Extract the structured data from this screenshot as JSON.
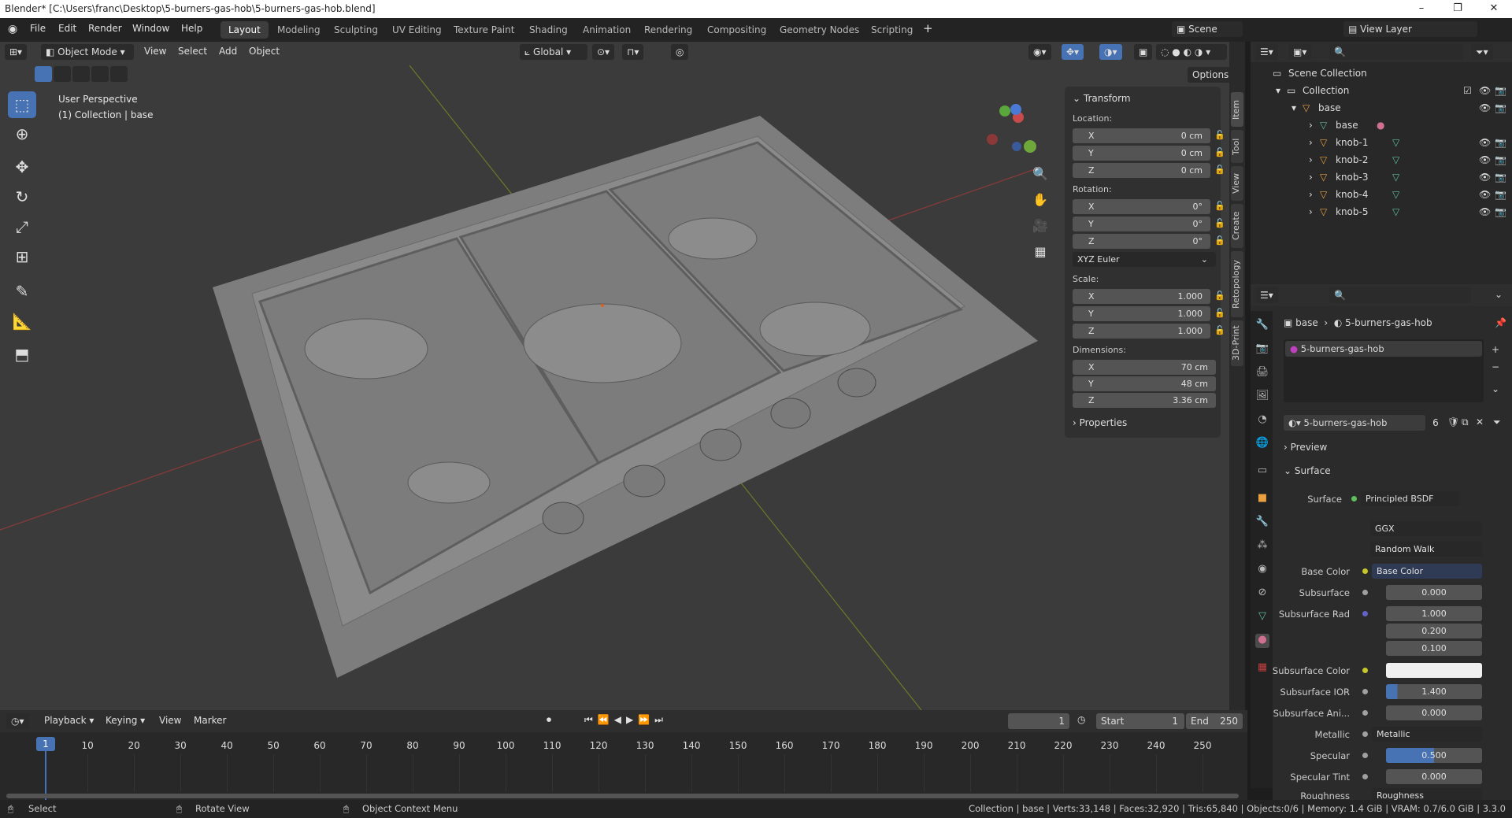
{
  "window": {
    "title": "Blender* [C:\\Users\\franc\\Desktop\\5-burners-gas-hob\\5-burners-gas-hob.blend]"
  },
  "menu": [
    "File",
    "Edit",
    "Render",
    "Window",
    "Help"
  ],
  "workspaces": [
    "Layout",
    "Modeling",
    "Sculpting",
    "UV Editing",
    "Texture Paint",
    "Shading",
    "Animation",
    "Rendering",
    "Compositing",
    "Geometry Nodes",
    "Scripting"
  ],
  "scene": "Scene",
  "view_layer": "View Layer",
  "viewport": {
    "mode": "Object Mode",
    "menus": [
      "View",
      "Select",
      "Add",
      "Object"
    ],
    "orientation": "Global",
    "options": "Options",
    "info_line1": "User Perspective",
    "info_line2": "(1) Collection | base"
  },
  "npanel": {
    "header": "Transform",
    "location_label": "Location:",
    "location": [
      {
        "k": "X",
        "v": "0 cm"
      },
      {
        "k": "Y",
        "v": "0 cm"
      },
      {
        "k": "Z",
        "v": "0 cm"
      }
    ],
    "rotation_label": "Rotation:",
    "rotation": [
      {
        "k": "X",
        "v": "0°"
      },
      {
        "k": "Y",
        "v": "0°"
      },
      {
        "k": "Z",
        "v": "0°"
      }
    ],
    "rotation_mode": "XYZ Euler",
    "scale_label": "Scale:",
    "scale": [
      {
        "k": "X",
        "v": "1.000"
      },
      {
        "k": "Y",
        "v": "1.000"
      },
      {
        "k": "Z",
        "v": "1.000"
      }
    ],
    "dimensions_label": "Dimensions:",
    "dimensions": [
      {
        "k": "X",
        "v": "70 cm"
      },
      {
        "k": "Y",
        "v": "48 cm"
      },
      {
        "k": "Z",
        "v": "3.36 cm"
      }
    ],
    "properties": "Properties",
    "tabs": [
      "Item",
      "Tool",
      "View",
      "Create",
      "Retopology",
      "3D-Print"
    ]
  },
  "outliner": {
    "scene_collection": "Scene Collection",
    "collection": "Collection",
    "items": [
      "base",
      "base",
      "knob-1",
      "knob-2",
      "knob-3",
      "knob-4",
      "knob-5"
    ]
  },
  "properties": {
    "breadcrumb_obj": "base",
    "breadcrumb_mat": "5-burners-gas-hob",
    "slot": "5-burners-gas-hob",
    "material": "5-burners-gas-hob",
    "users": "6",
    "preview": "Preview",
    "surface_header": "Surface",
    "rows": [
      {
        "l": "Surface",
        "v": "Principled BSDF",
        "c": "#5fbf5f"
      },
      {
        "l": "",
        "v": "GGX",
        "c": ""
      },
      {
        "l": "",
        "v": "Random Walk",
        "c": ""
      },
      {
        "l": "Base Color",
        "v": "Base Color",
        "c": "#c7c729"
      },
      {
        "l": "Subsurface",
        "v": "0.000",
        "c": "#a0a0a0"
      },
      {
        "l": "Subsurface Rad",
        "v": "1.000",
        "c": "#6363c7"
      },
      {
        "l": "",
        "v": "0.200",
        "c": ""
      },
      {
        "l": "",
        "v": "0.100",
        "c": ""
      },
      {
        "l": "Subsurface Color",
        "v": "",
        "c": "#c7c729"
      },
      {
        "l": "Subsurface IOR",
        "v": "1.400",
        "c": "#a0a0a0"
      },
      {
        "l": "Subsurface Ani...",
        "v": "0.000",
        "c": "#a0a0a0"
      },
      {
        "l": "Metallic",
        "v": "Metallic",
        "c": "#a0a0a0"
      },
      {
        "l": "Specular",
        "v": "0.500",
        "c": "#a0a0a0"
      },
      {
        "l": "Specular Tint",
        "v": "0.000",
        "c": "#a0a0a0"
      },
      {
        "l": "Roughness",
        "v": "Roughness",
        "c": "#a0a0a0"
      }
    ]
  },
  "timeline": {
    "menus": [
      "Playback",
      "Keying",
      "View",
      "Marker"
    ],
    "current": "1",
    "start_label": "Start",
    "start": "1",
    "end_label": "End",
    "end": "250",
    "ticks": [
      "1",
      "10",
      "20",
      "30",
      "40",
      "50",
      "60",
      "70",
      "80",
      "90",
      "100",
      "110",
      "120",
      "130",
      "140",
      "150",
      "160",
      "170",
      "180",
      "190",
      "200",
      "210",
      "220",
      "230",
      "240",
      "250"
    ]
  },
  "status": {
    "select": "Select",
    "rotate": "Rotate View",
    "context": "Object Context Menu",
    "stats": "Collection | base | Verts:33,148 | Faces:32,920 | Tris:65,840 | Objects:0/6 | Memory: 1.4 GiB | VRAM: 0.7/6.0 GiB | 3.3.0"
  }
}
